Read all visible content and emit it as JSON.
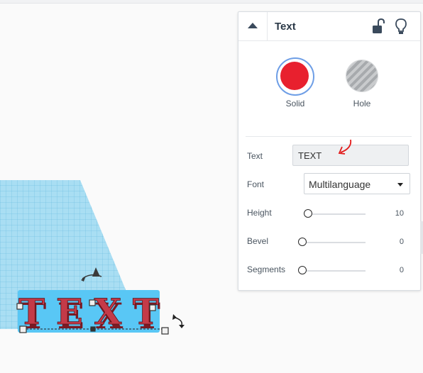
{
  "panel": {
    "title": "Text",
    "icons": {
      "collapse": "chevron-up-icon",
      "lock": "unlock-icon",
      "bulb": "lightbulb-icon"
    },
    "modes": {
      "solid_label": "Solid",
      "hole_label": "Hole",
      "solid_color": "#e8202e"
    },
    "fields": {
      "text_label": "Text",
      "text_value": "TEXT",
      "font_label": "Font",
      "font_value": "Multilanguage",
      "height_label": "Height",
      "height_value": "10",
      "bevel_label": "Bevel",
      "bevel_value": "0",
      "segments_label": "Segments",
      "segments_value": "0"
    }
  },
  "colors": {
    "grid": "#8dd3ee",
    "text_shape": "#c43a48",
    "selection": "#59c7f5",
    "annotation": "#e21b1b"
  }
}
